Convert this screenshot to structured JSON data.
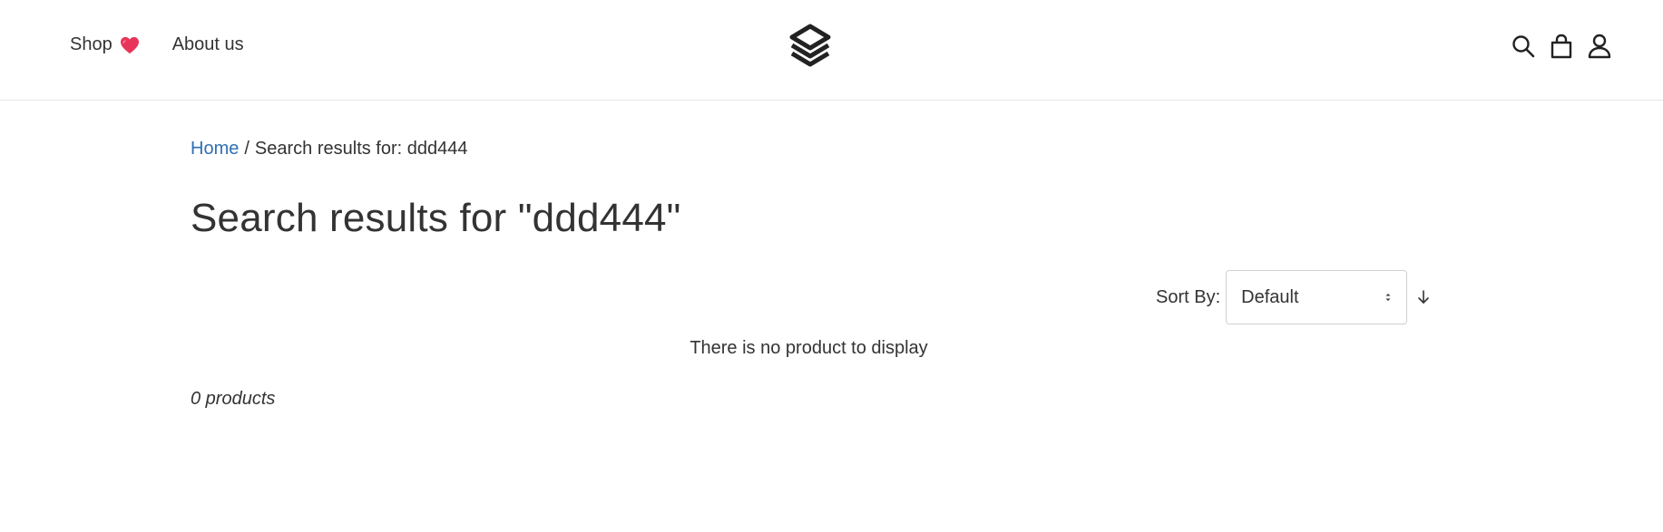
{
  "header": {
    "nav": [
      {
        "label": "Shop"
      },
      {
        "label": "About us"
      }
    ],
    "icons": [
      "search-icon",
      "shopping-bag-icon",
      "user-icon"
    ]
  },
  "breadcrumb": {
    "home": "Home",
    "separator": "/",
    "current": "Search results for: ddd444"
  },
  "page": {
    "title": "Search results for \"ddd444\"",
    "empty_message": "There is no product to display",
    "count": "0 products"
  },
  "sort": {
    "label": "Sort By:",
    "selected": "Default"
  },
  "colors": {
    "link": "#2f6fb5",
    "heart": "#e8345a",
    "text": "#333333"
  }
}
